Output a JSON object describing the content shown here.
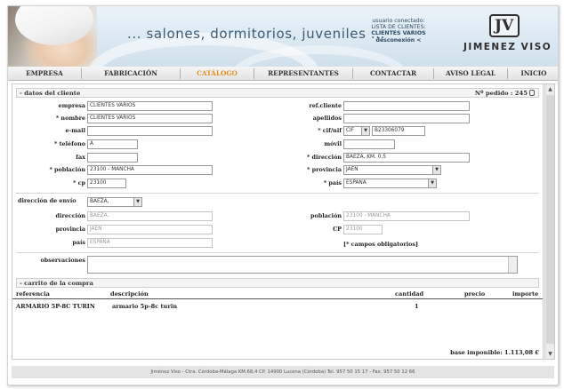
{
  "header": {
    "tagline": "... salones, dormitorios, juveniles ...",
    "user_line1": "usuario conectado:",
    "user_line2": "LISTA DE CLIENTES:",
    "user_line3": "CLIENTES VARIOS",
    "user_line4": "desconexión <",
    "logo_text": "JIMENEZ VISO",
    "logo_mark": "JV"
  },
  "nav": {
    "tabs": [
      {
        "label": "EMPRESA"
      },
      {
        "label": "FABRICACIÓN"
      },
      {
        "label": "CATÁLOGO",
        "active": true
      },
      {
        "label": "REPRESENTANTES"
      },
      {
        "label": "CONTACTAR"
      },
      {
        "label": "AVISO LEGAL"
      },
      {
        "label": "INICIO"
      }
    ]
  },
  "client": {
    "section_title": "- datos del cliente",
    "order_label": "Nº pedido : 245",
    "labels": {
      "empresa": "empresa",
      "nombre": "* nombre",
      "email": "e-mail",
      "telefono": "* teléfono",
      "fax": "fax",
      "poblacion": "* población",
      "cp": "* cp",
      "ref_cliente": "ref.cliente",
      "apellidos": "apellidos",
      "cif_nif": "* cif/nif",
      "movil": "móvil",
      "direccion": "* dirección",
      "provincia": "* provincia",
      "pais": "* país"
    },
    "values": {
      "empresa": "CLIENTES VARIOS",
      "nombre": "CLIENTES VARIOS",
      "email": "",
      "telefono": "A",
      "fax": "",
      "poblacion": "23100 - MANCHA",
      "cp": "23100",
      "ref_cliente": "",
      "apellidos": "",
      "cif_type": "CIF",
      "cif_number": "B23306079",
      "movil": "",
      "direccion": "BAEZA, KM. 0.5",
      "provincia": "JAEN",
      "pais": "ESPAÑA"
    }
  },
  "shipping": {
    "selector_label": "dirección de envío",
    "selector_value": "BAEZA,",
    "labels": {
      "direccion": "dirección",
      "provincia": "provincia",
      "pais": "país",
      "poblacion": "población",
      "cp": "CP"
    },
    "values": {
      "direccion": "BAEZA,",
      "provincia": "JAEN",
      "pais": "ESPAÑA",
      "poblacion": "23100 - MANCHA",
      "cp": "23100"
    },
    "required_note": "[* campos obligatorios]",
    "observaciones_label": "observaciones",
    "observaciones_value": ""
  },
  "cart": {
    "section_title": "- carrito de la compra",
    "columns": {
      "referencia": "referencia",
      "descripcion": "descripción",
      "cantidad": "cantidad",
      "precio": "precio",
      "importe": "importe"
    },
    "rows": [
      {
        "referencia": "ARMARIO 5P-8C TURIN",
        "descripcion": "armario 5p-8c turin",
        "cantidad": "1",
        "precio": "",
        "importe": ""
      }
    ],
    "base_imponible": "base imponible: 1.113,08 €"
  },
  "footer": {
    "text": "Jiménez Viso - Ctra. Córdoba-Málaga KM.68,4 CP. 14900 Lucena (Córdoba) Tel. 957 50 15 17 - Fax. 957 50 12 66"
  }
}
